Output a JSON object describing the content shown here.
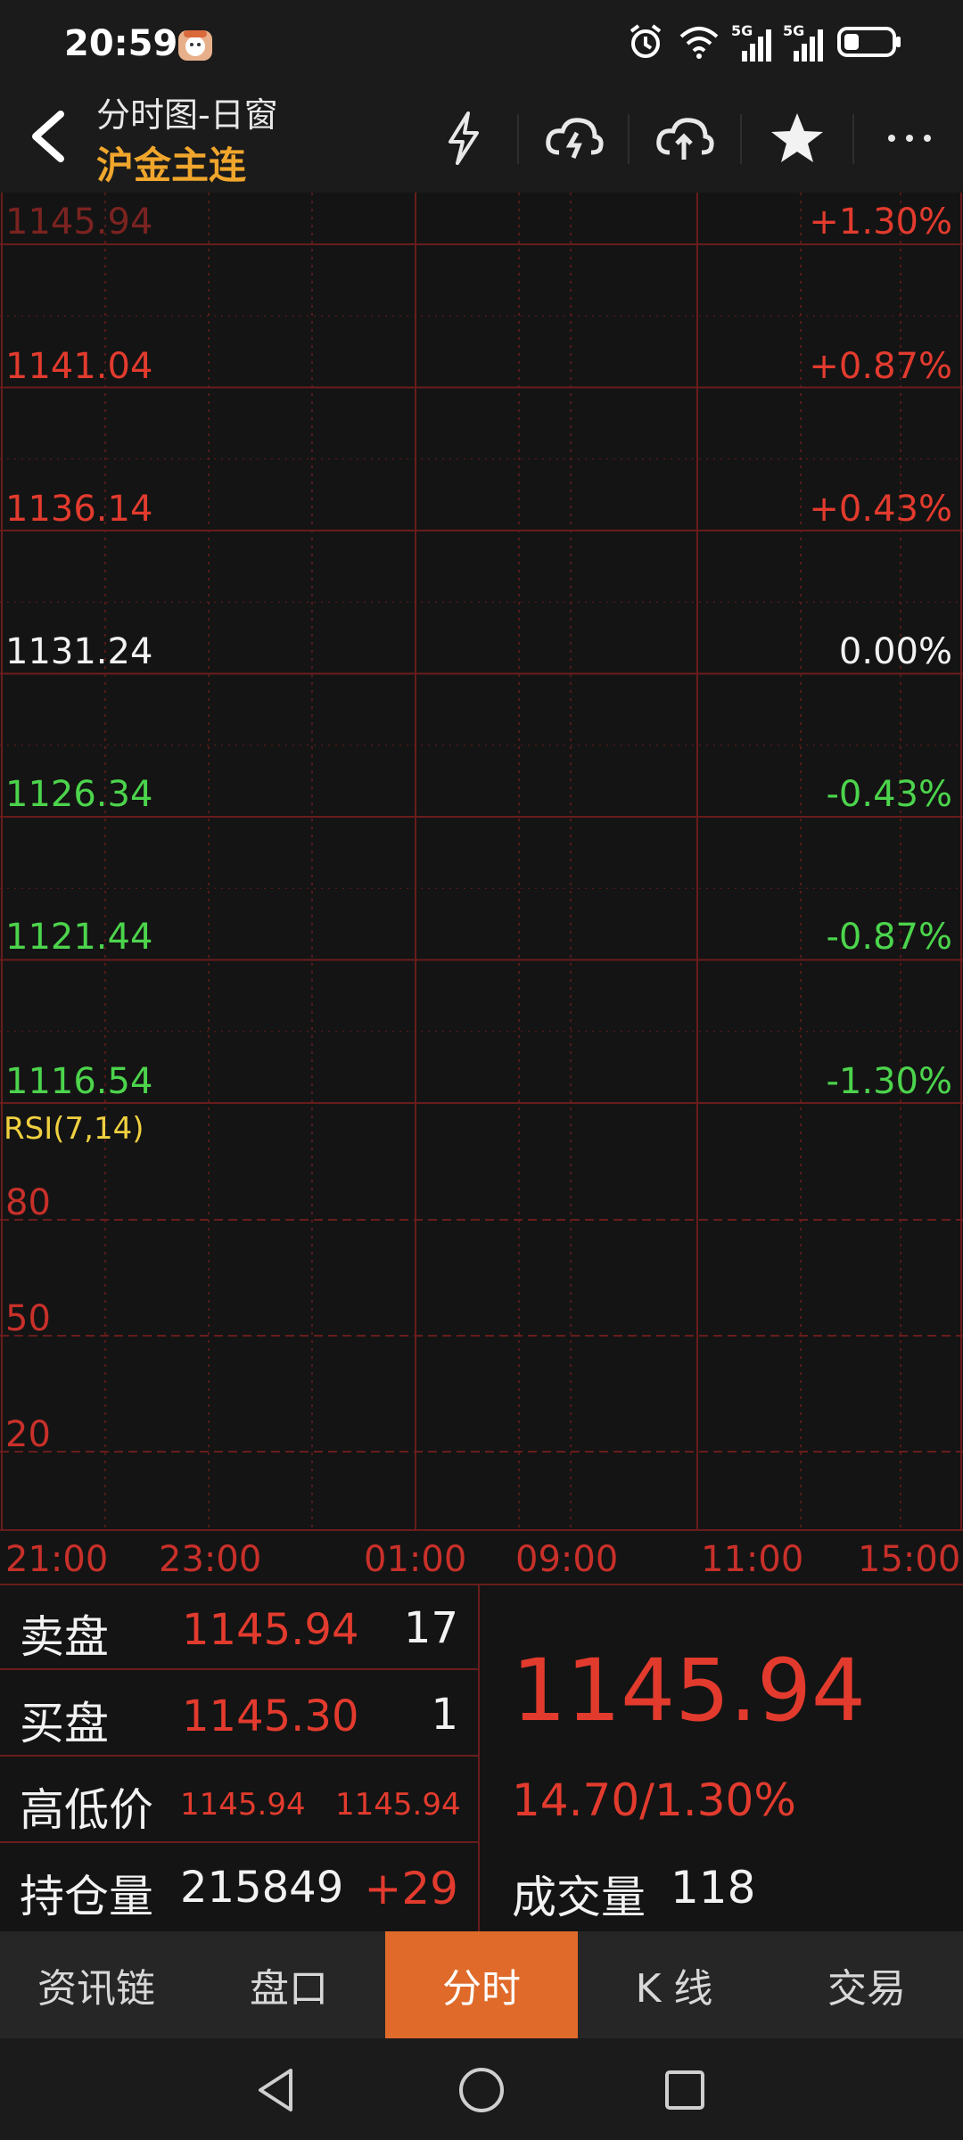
{
  "status_bar": {
    "time": "20:59",
    "network_labels": [
      "5G",
      "5G"
    ],
    "icons": [
      "alarm-icon",
      "wifi-icon",
      "signal-icon",
      "signal-icon",
      "battery-icon"
    ]
  },
  "header": {
    "title": "分时图-日窗",
    "subtitle": "沪金主连",
    "buttons": [
      "lightning-icon",
      "cloud-download-icon",
      "cloud-upload-icon",
      "star-icon",
      "more-icon"
    ]
  },
  "chart": {
    "price_labels": [
      {
        "price": "1145.94",
        "pct": "+1.30%",
        "tone": "up_dim"
      },
      {
        "price": "1141.04",
        "pct": "+0.87%",
        "tone": "up"
      },
      {
        "price": "1136.14",
        "pct": "+0.43%",
        "tone": "up"
      },
      {
        "price": "1131.24",
        "pct": "0.00%",
        "tone": "flat"
      },
      {
        "price": "1126.34",
        "pct": "-0.43%",
        "tone": "down"
      },
      {
        "price": "1121.44",
        "pct": "-0.87%",
        "tone": "down"
      },
      {
        "price": "1116.54",
        "pct": "-1.30%",
        "tone": "down"
      }
    ],
    "indicator_label": "RSI(7,14)",
    "rsi_levels": [
      "80",
      "50",
      "20"
    ],
    "time_labels": [
      "21:00",
      "23:00",
      "01:00",
      "09:00",
      "11:00",
      "15:00"
    ],
    "colors": {
      "up": "#e23b2e",
      "down": "#4cd44c",
      "flat": "#f2f2f2",
      "grid": "#6a1c1c",
      "indicator": "#f0d040"
    }
  },
  "quote": {
    "ask_label": "卖盘",
    "ask_price": "1145.94",
    "ask_volume": "17",
    "bid_label": "买盘",
    "bid_price": "1145.30",
    "bid_volume": "1",
    "hilo_label": "高低价",
    "high": "1145.94",
    "low": "1145.94",
    "oi_label": "持仓量",
    "oi_value": "215849",
    "oi_change": "+29",
    "last_price": "1145.94",
    "change": "14.70/1.30%",
    "turnover_label": "成交量",
    "turnover_value": "118"
  },
  "tabs": [
    {
      "label": "资讯链",
      "active": false
    },
    {
      "label": "盘口",
      "active": false
    },
    {
      "label": "分时",
      "active": true
    },
    {
      "label": "K 线",
      "active": false
    },
    {
      "label": "交易",
      "active": false
    }
  ],
  "navbar": [
    "back-triangle-icon",
    "home-circle-icon",
    "recents-square-icon"
  ]
}
